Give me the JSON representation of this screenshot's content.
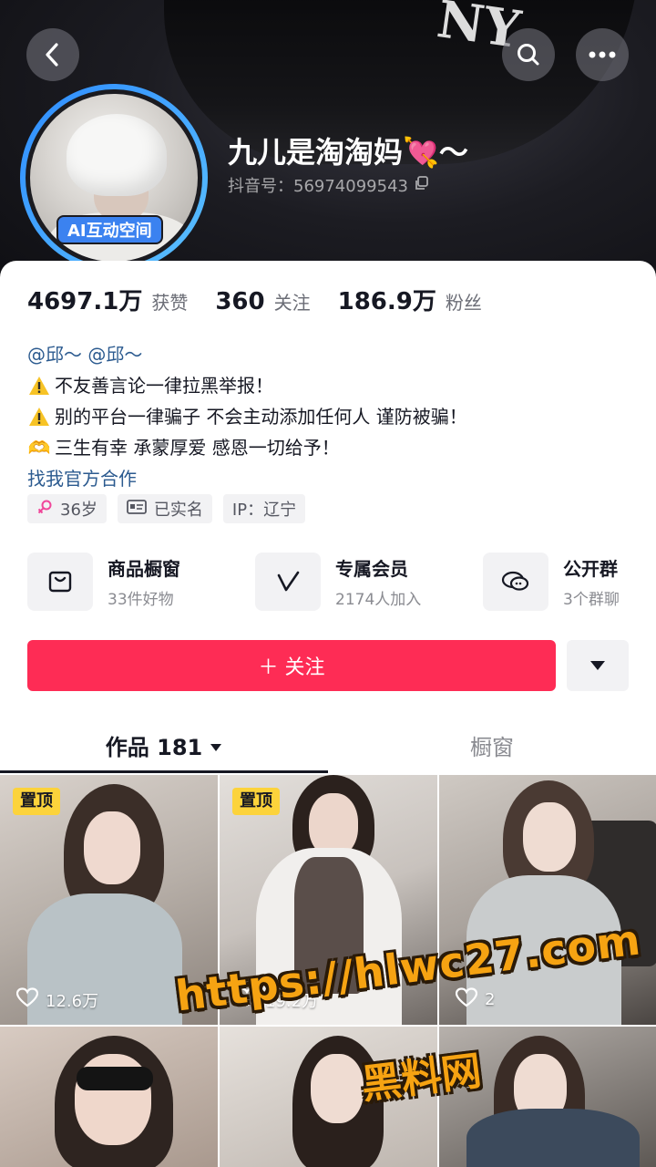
{
  "header": {
    "name": "九儿是淘淘妈💘～",
    "douyin_id": "抖音号：56974099543",
    "ai_badge": "AI互动空间",
    "back_icon": "chevron-left-icon",
    "search_icon": "search-icon",
    "more_icon": "more-horizontal-icon",
    "cap_logo": "NY"
  },
  "stats": [
    {
      "num": "4697.1万",
      "label": "获赞"
    },
    {
      "num": "360",
      "label": "关注"
    },
    {
      "num": "186.9万",
      "label": "粉丝"
    }
  ],
  "bio": {
    "mentions": "@邱～ @邱～",
    "line1": "不友善言论一律拉黑举报！",
    "line2": "别的平台一律骗子 不会主动添加任何人 谨防被骗！",
    "line3": "三生有幸 承蒙厚爱 感恩一切给予！",
    "line3_emoji": "🫶",
    "contact": "找我官方合作"
  },
  "tags": [
    {
      "label": "36岁",
      "icon": "female-icon"
    },
    {
      "label": "已实名",
      "icon": "id-card-icon"
    },
    {
      "label": "IP：辽宁",
      "icon": ""
    }
  ],
  "features": [
    {
      "title": "商品橱窗",
      "sub": "33件好物",
      "icon": "shopping-bag-icon"
    },
    {
      "title": "专属会员",
      "sub": "2174人加入",
      "icon": "vip-icon"
    },
    {
      "title": "公开群",
      "sub": "3个群聊",
      "icon": "chat-group-icon"
    }
  ],
  "actions": {
    "follow": "＋ 关注",
    "more_icon": "caret-down-icon"
  },
  "tabs": [
    {
      "label": "作品 181",
      "active": true
    },
    {
      "label": "橱窗",
      "active": false
    }
  ],
  "videos": [
    {
      "pinned": "置顶",
      "likes": "12.6万"
    },
    {
      "pinned": "置顶",
      "likes": "19.2万"
    },
    {
      "pinned": "",
      "likes": "2"
    },
    {
      "pinned": "",
      "likes": ""
    },
    {
      "pinned": "",
      "likes": ""
    },
    {
      "pinned": "",
      "likes": ""
    }
  ],
  "watermark": {
    "url": "https://hlwc27.com",
    "cn": "黑料网"
  },
  "colors": {
    "accent": "#fe2c55",
    "link": "#2b5a8f",
    "pin": "#fcd33b",
    "watermark": "#f6a312"
  }
}
